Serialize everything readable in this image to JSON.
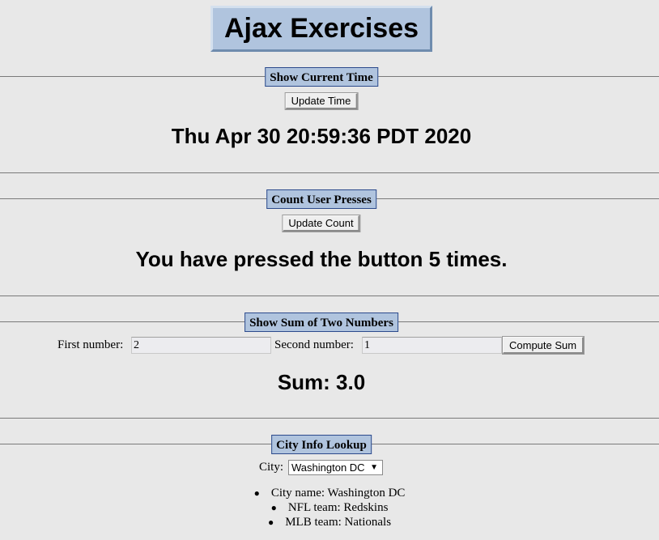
{
  "page": {
    "title": "Ajax Exercises"
  },
  "time_section": {
    "legend": "Show Current Time",
    "button_label": "Update Time",
    "result": "Thu Apr 30 20:59:36 PDT 2020"
  },
  "count_section": {
    "legend": "Count User Presses",
    "button_label": "Update Count",
    "result": "You have pressed the button 5 times."
  },
  "sum_section": {
    "legend": "Show Sum of Two Numbers",
    "first_label": "First number:",
    "first_value": "2",
    "second_label": "Second number:",
    "second_value": "1",
    "button_label": "Compute Sum",
    "result": "Sum: 3.0"
  },
  "city_section": {
    "legend": "City Info Lookup",
    "city_label": "City:",
    "selected_city": "Washington DC",
    "info": [
      "City name: Washington DC",
      "NFL team: Redskins",
      "MLB team: Nationals"
    ]
  },
  "colors": {
    "background": "#e8e8e8",
    "legend_bg": "#b0c4de",
    "legend_border": "#2c4a8c"
  },
  "icons": {
    "select_arrow": "chevron-down-icon"
  }
}
